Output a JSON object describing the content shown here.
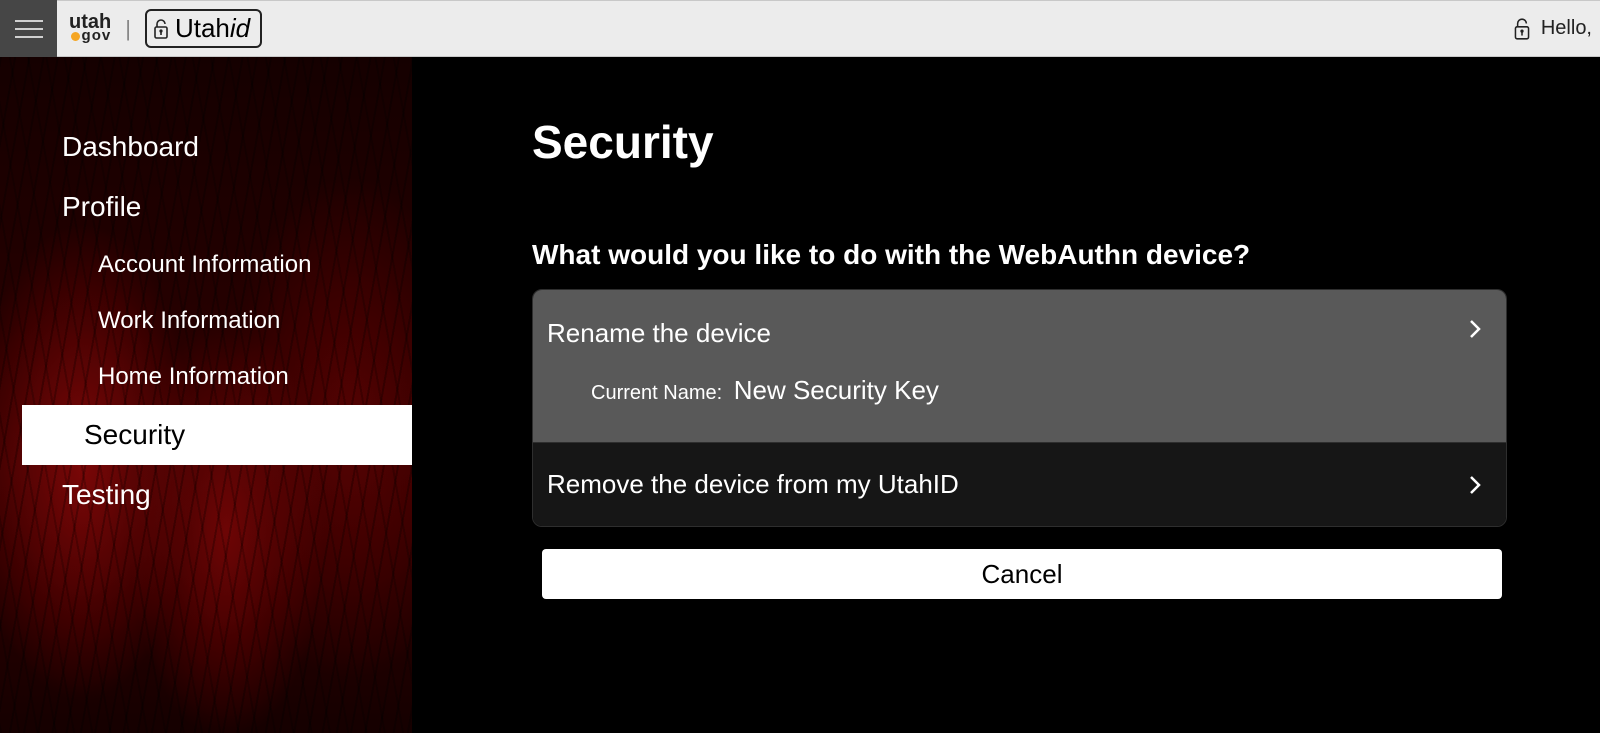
{
  "header": {
    "brand_utah": "utah",
    "brand_gov": "gov",
    "brand_utahid_prefix": "Utah",
    "brand_utahid_suffix": "id",
    "hello": "Hello,"
  },
  "sidebar": {
    "items": [
      {
        "label": "Dashboard",
        "level": 1,
        "active": false
      },
      {
        "label": "Profile",
        "level": 1,
        "active": false
      },
      {
        "label": "Account Information",
        "level": 2,
        "active": false
      },
      {
        "label": "Work Information",
        "level": 2,
        "active": false
      },
      {
        "label": "Home Information",
        "level": 2,
        "active": false
      },
      {
        "label": "Security",
        "level": 1,
        "active": true
      },
      {
        "label": "Testing",
        "level": 1,
        "active": false
      }
    ]
  },
  "main": {
    "title": "Security",
    "question": "What would you like to do with the WebAuthn device?",
    "option_rename": "Rename the device",
    "current_name_label": "Current Name:",
    "current_name_value": "New Security Key",
    "option_remove": "Remove the device from my UtahID",
    "cancel": "Cancel"
  }
}
